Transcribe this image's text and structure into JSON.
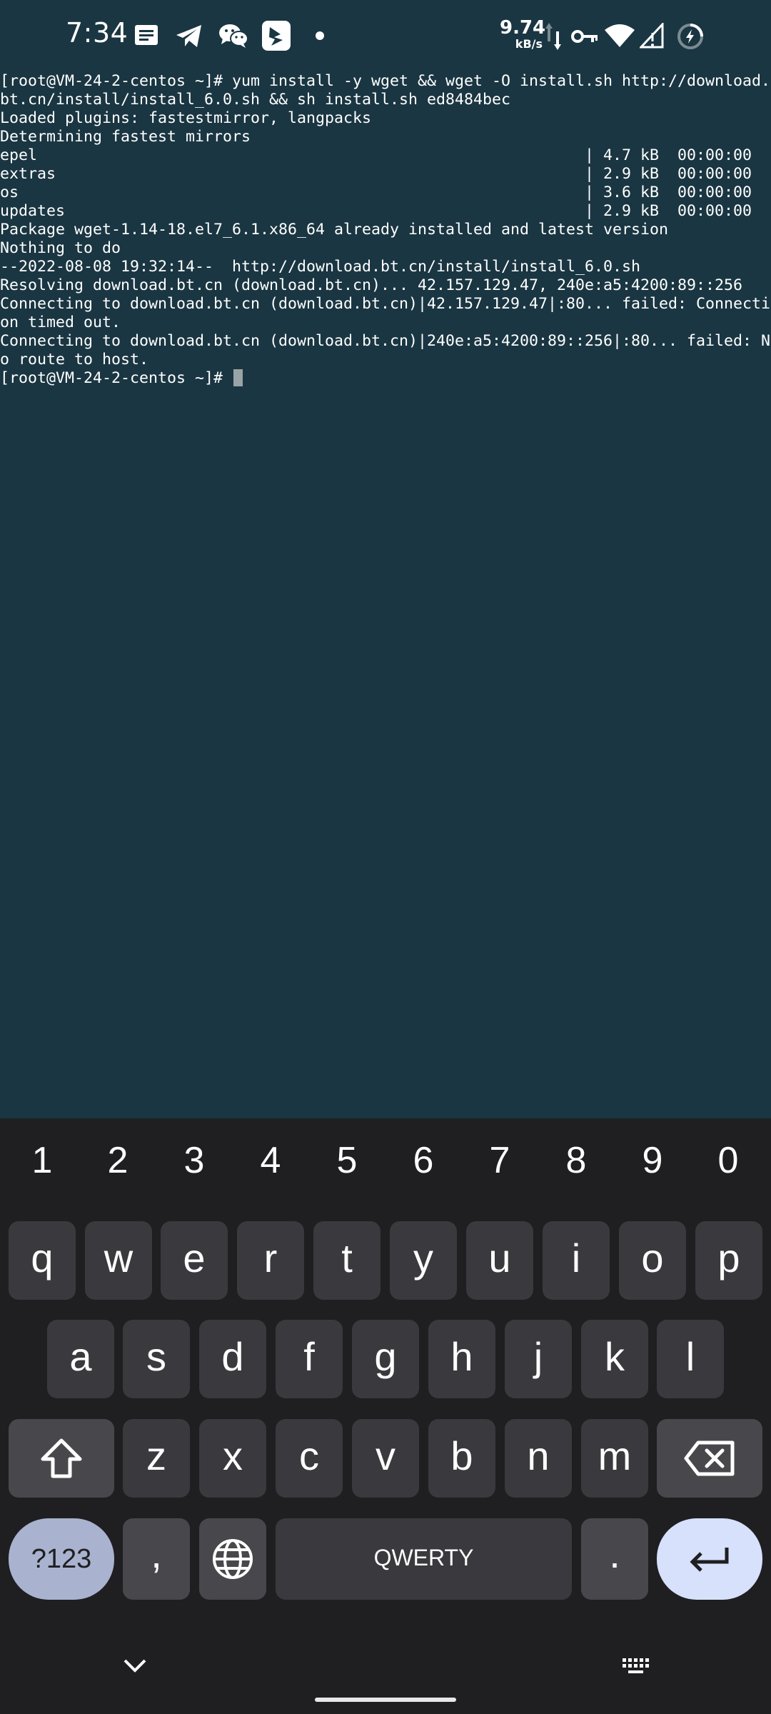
{
  "status_bar": {
    "time": "7:34",
    "net_speed_value": "9.74",
    "net_speed_unit": "kB/s",
    "icons": [
      "message-icon",
      "telegram-icon",
      "wechat-icon",
      "app-icon",
      "dot-icon",
      "data-arrows-icon",
      "vpn-key-icon",
      "wifi-icon",
      "signal-icon",
      "battery-charging-icon"
    ]
  },
  "terminal": {
    "lines": [
      "[root@VM-24-2-centos ~]# yum install -y wget && wget -O install.sh http://download.",
      "bt.cn/install/install_6.0.sh && sh install.sh ed8484bec",
      "Loaded plugins: fastestmirror, langpacks",
      "Determining fastest mirrors",
      "epel                                                           | 4.7 kB  00:00:00",
      "extras                                                         | 2.9 kB  00:00:00",
      "os                                                             | 3.6 kB  00:00:00",
      "updates                                                        | 2.9 kB  00:00:00",
      "Package wget-1.14-18.el7_6.1.x86_64 already installed and latest version",
      "Nothing to do",
      "--2022-08-08 19:32:14--  http://download.bt.cn/install/install_6.0.sh",
      "Resolving download.bt.cn (download.bt.cn)... 42.157.129.47, 240e:a5:4200:89::256",
      "Connecting to download.bt.cn (download.bt.cn)|42.157.129.47|:80... failed: Connecti",
      "on timed out.",
      "Connecting to download.bt.cn (download.bt.cn)|240e:a5:4200:89::256|:80... failed: N",
      "o route to host."
    ],
    "prompt": "[root@VM-24-2-centos ~]# "
  },
  "keyboard": {
    "number_row": [
      "1",
      "2",
      "3",
      "4",
      "5",
      "6",
      "7",
      "8",
      "9",
      "0"
    ],
    "row1": [
      "q",
      "w",
      "e",
      "r",
      "t",
      "y",
      "u",
      "i",
      "o",
      "p"
    ],
    "row2": [
      "a",
      "s",
      "d",
      "f",
      "g",
      "h",
      "j",
      "k",
      "l"
    ],
    "row3": [
      "z",
      "x",
      "c",
      "v",
      "b",
      "n",
      "m"
    ],
    "symbols_label": "?123",
    "comma_label": ",",
    "space_label": "QWERTY",
    "period_label": ".",
    "colors": {
      "background": "#1f1f22",
      "key": "#3a3a3e",
      "function_key": "#48484c",
      "symbols_key": "#a9b3cf",
      "enter_key": "#d7e1fb"
    }
  },
  "colors": {
    "terminal_background": "#1a3642",
    "terminal_text": "#ffffff"
  }
}
